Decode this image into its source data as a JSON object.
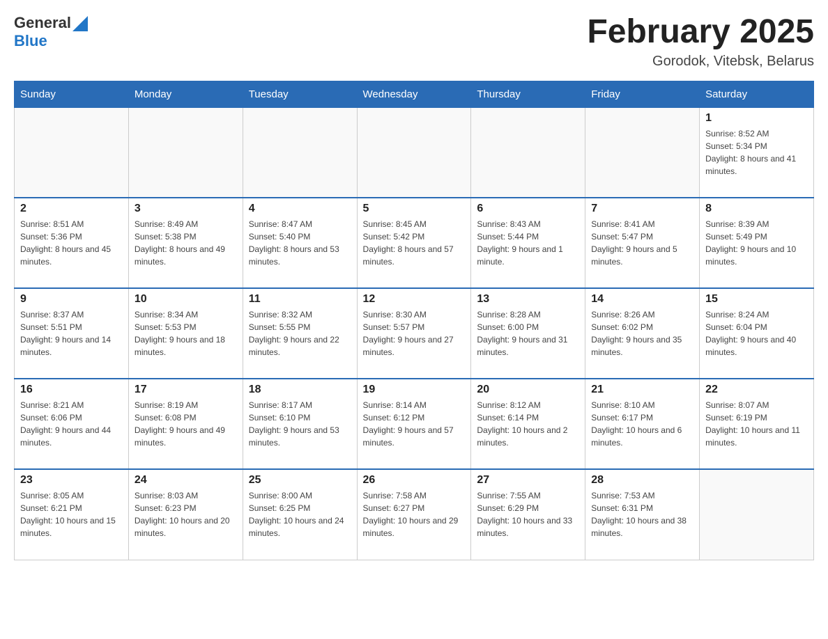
{
  "header": {
    "logo_general": "General",
    "logo_blue": "Blue",
    "title": "February 2025",
    "subtitle": "Gorodok, Vitebsk, Belarus"
  },
  "weekdays": [
    "Sunday",
    "Monday",
    "Tuesday",
    "Wednesday",
    "Thursday",
    "Friday",
    "Saturday"
  ],
  "weeks": [
    [
      {
        "day": "",
        "info": ""
      },
      {
        "day": "",
        "info": ""
      },
      {
        "day": "",
        "info": ""
      },
      {
        "day": "",
        "info": ""
      },
      {
        "day": "",
        "info": ""
      },
      {
        "day": "",
        "info": ""
      },
      {
        "day": "1",
        "info": "Sunrise: 8:52 AM\nSunset: 5:34 PM\nDaylight: 8 hours and 41 minutes."
      }
    ],
    [
      {
        "day": "2",
        "info": "Sunrise: 8:51 AM\nSunset: 5:36 PM\nDaylight: 8 hours and 45 minutes."
      },
      {
        "day": "3",
        "info": "Sunrise: 8:49 AM\nSunset: 5:38 PM\nDaylight: 8 hours and 49 minutes."
      },
      {
        "day": "4",
        "info": "Sunrise: 8:47 AM\nSunset: 5:40 PM\nDaylight: 8 hours and 53 minutes."
      },
      {
        "day": "5",
        "info": "Sunrise: 8:45 AM\nSunset: 5:42 PM\nDaylight: 8 hours and 57 minutes."
      },
      {
        "day": "6",
        "info": "Sunrise: 8:43 AM\nSunset: 5:44 PM\nDaylight: 9 hours and 1 minute."
      },
      {
        "day": "7",
        "info": "Sunrise: 8:41 AM\nSunset: 5:47 PM\nDaylight: 9 hours and 5 minutes."
      },
      {
        "day": "8",
        "info": "Sunrise: 8:39 AM\nSunset: 5:49 PM\nDaylight: 9 hours and 10 minutes."
      }
    ],
    [
      {
        "day": "9",
        "info": "Sunrise: 8:37 AM\nSunset: 5:51 PM\nDaylight: 9 hours and 14 minutes."
      },
      {
        "day": "10",
        "info": "Sunrise: 8:34 AM\nSunset: 5:53 PM\nDaylight: 9 hours and 18 minutes."
      },
      {
        "day": "11",
        "info": "Sunrise: 8:32 AM\nSunset: 5:55 PM\nDaylight: 9 hours and 22 minutes."
      },
      {
        "day": "12",
        "info": "Sunrise: 8:30 AM\nSunset: 5:57 PM\nDaylight: 9 hours and 27 minutes."
      },
      {
        "day": "13",
        "info": "Sunrise: 8:28 AM\nSunset: 6:00 PM\nDaylight: 9 hours and 31 minutes."
      },
      {
        "day": "14",
        "info": "Sunrise: 8:26 AM\nSunset: 6:02 PM\nDaylight: 9 hours and 35 minutes."
      },
      {
        "day": "15",
        "info": "Sunrise: 8:24 AM\nSunset: 6:04 PM\nDaylight: 9 hours and 40 minutes."
      }
    ],
    [
      {
        "day": "16",
        "info": "Sunrise: 8:21 AM\nSunset: 6:06 PM\nDaylight: 9 hours and 44 minutes."
      },
      {
        "day": "17",
        "info": "Sunrise: 8:19 AM\nSunset: 6:08 PM\nDaylight: 9 hours and 49 minutes."
      },
      {
        "day": "18",
        "info": "Sunrise: 8:17 AM\nSunset: 6:10 PM\nDaylight: 9 hours and 53 minutes."
      },
      {
        "day": "19",
        "info": "Sunrise: 8:14 AM\nSunset: 6:12 PM\nDaylight: 9 hours and 57 minutes."
      },
      {
        "day": "20",
        "info": "Sunrise: 8:12 AM\nSunset: 6:14 PM\nDaylight: 10 hours and 2 minutes."
      },
      {
        "day": "21",
        "info": "Sunrise: 8:10 AM\nSunset: 6:17 PM\nDaylight: 10 hours and 6 minutes."
      },
      {
        "day": "22",
        "info": "Sunrise: 8:07 AM\nSunset: 6:19 PM\nDaylight: 10 hours and 11 minutes."
      }
    ],
    [
      {
        "day": "23",
        "info": "Sunrise: 8:05 AM\nSunset: 6:21 PM\nDaylight: 10 hours and 15 minutes."
      },
      {
        "day": "24",
        "info": "Sunrise: 8:03 AM\nSunset: 6:23 PM\nDaylight: 10 hours and 20 minutes."
      },
      {
        "day": "25",
        "info": "Sunrise: 8:00 AM\nSunset: 6:25 PM\nDaylight: 10 hours and 24 minutes."
      },
      {
        "day": "26",
        "info": "Sunrise: 7:58 AM\nSunset: 6:27 PM\nDaylight: 10 hours and 29 minutes."
      },
      {
        "day": "27",
        "info": "Sunrise: 7:55 AM\nSunset: 6:29 PM\nDaylight: 10 hours and 33 minutes."
      },
      {
        "day": "28",
        "info": "Sunrise: 7:53 AM\nSunset: 6:31 PM\nDaylight: 10 hours and 38 minutes."
      },
      {
        "day": "",
        "info": ""
      }
    ]
  ]
}
